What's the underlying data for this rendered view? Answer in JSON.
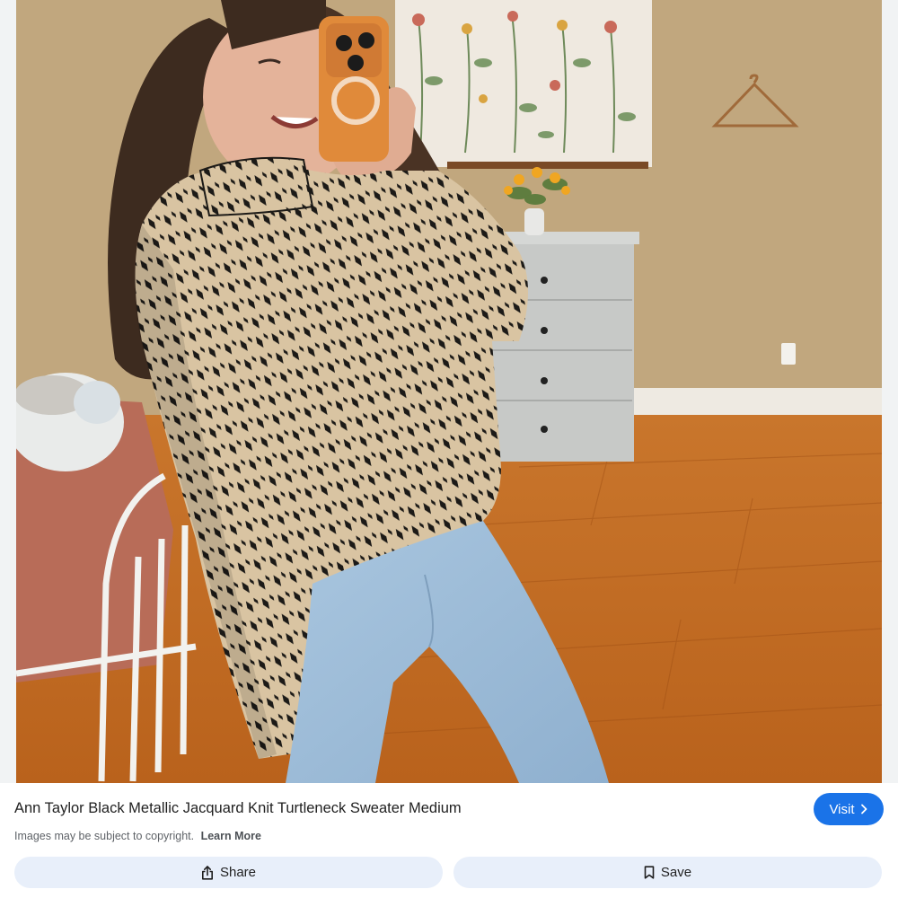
{
  "result": {
    "title": "Ann Taylor Black Metallic Jacquard Knit Turtleneck Sweater Medium",
    "visit_label": "Visit",
    "copyright_notice": "Images may be subject to copyright.",
    "learn_more_label": "Learn More"
  },
  "actions": {
    "share_label": "Share",
    "save_label": "Save"
  },
  "icons": {
    "visit": "chevron-right-icon",
    "share": "share-icon",
    "save": "bookmark-icon"
  },
  "colors": {
    "accent": "#1a73e8",
    "action_button_bg": "#e8effa",
    "text_primary": "#1f1f1f",
    "text_secondary": "#5f6368"
  }
}
